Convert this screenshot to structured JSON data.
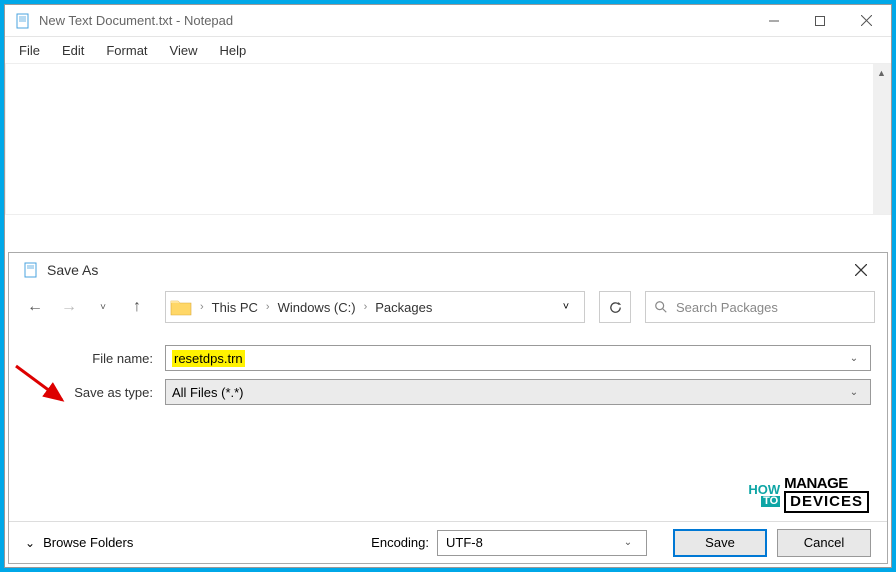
{
  "notepad": {
    "title": "New Text Document.txt - Notepad",
    "menus": [
      "File",
      "Edit",
      "Format",
      "View",
      "Help"
    ]
  },
  "saveAs": {
    "title": "Save As",
    "path": {
      "segments": [
        "This PC",
        "Windows (C:)",
        "Packages"
      ]
    },
    "search": {
      "placeholder": "Search Packages"
    },
    "fileNameLabel": "File name:",
    "fileNameValue": "resetdps.trn",
    "saveAsTypeLabel": "Save as type:",
    "saveAsTypeValue": "All Files  (*.*)",
    "browseFolders": "Browse Folders",
    "encodingLabel": "Encoding:",
    "encodingValue": "UTF-8",
    "saveButton": "Save",
    "cancelButton": "Cancel"
  },
  "watermark": {
    "how": "HOW",
    "to": "TO",
    "manage": "MANAGE",
    "devices": "DEVICES"
  }
}
